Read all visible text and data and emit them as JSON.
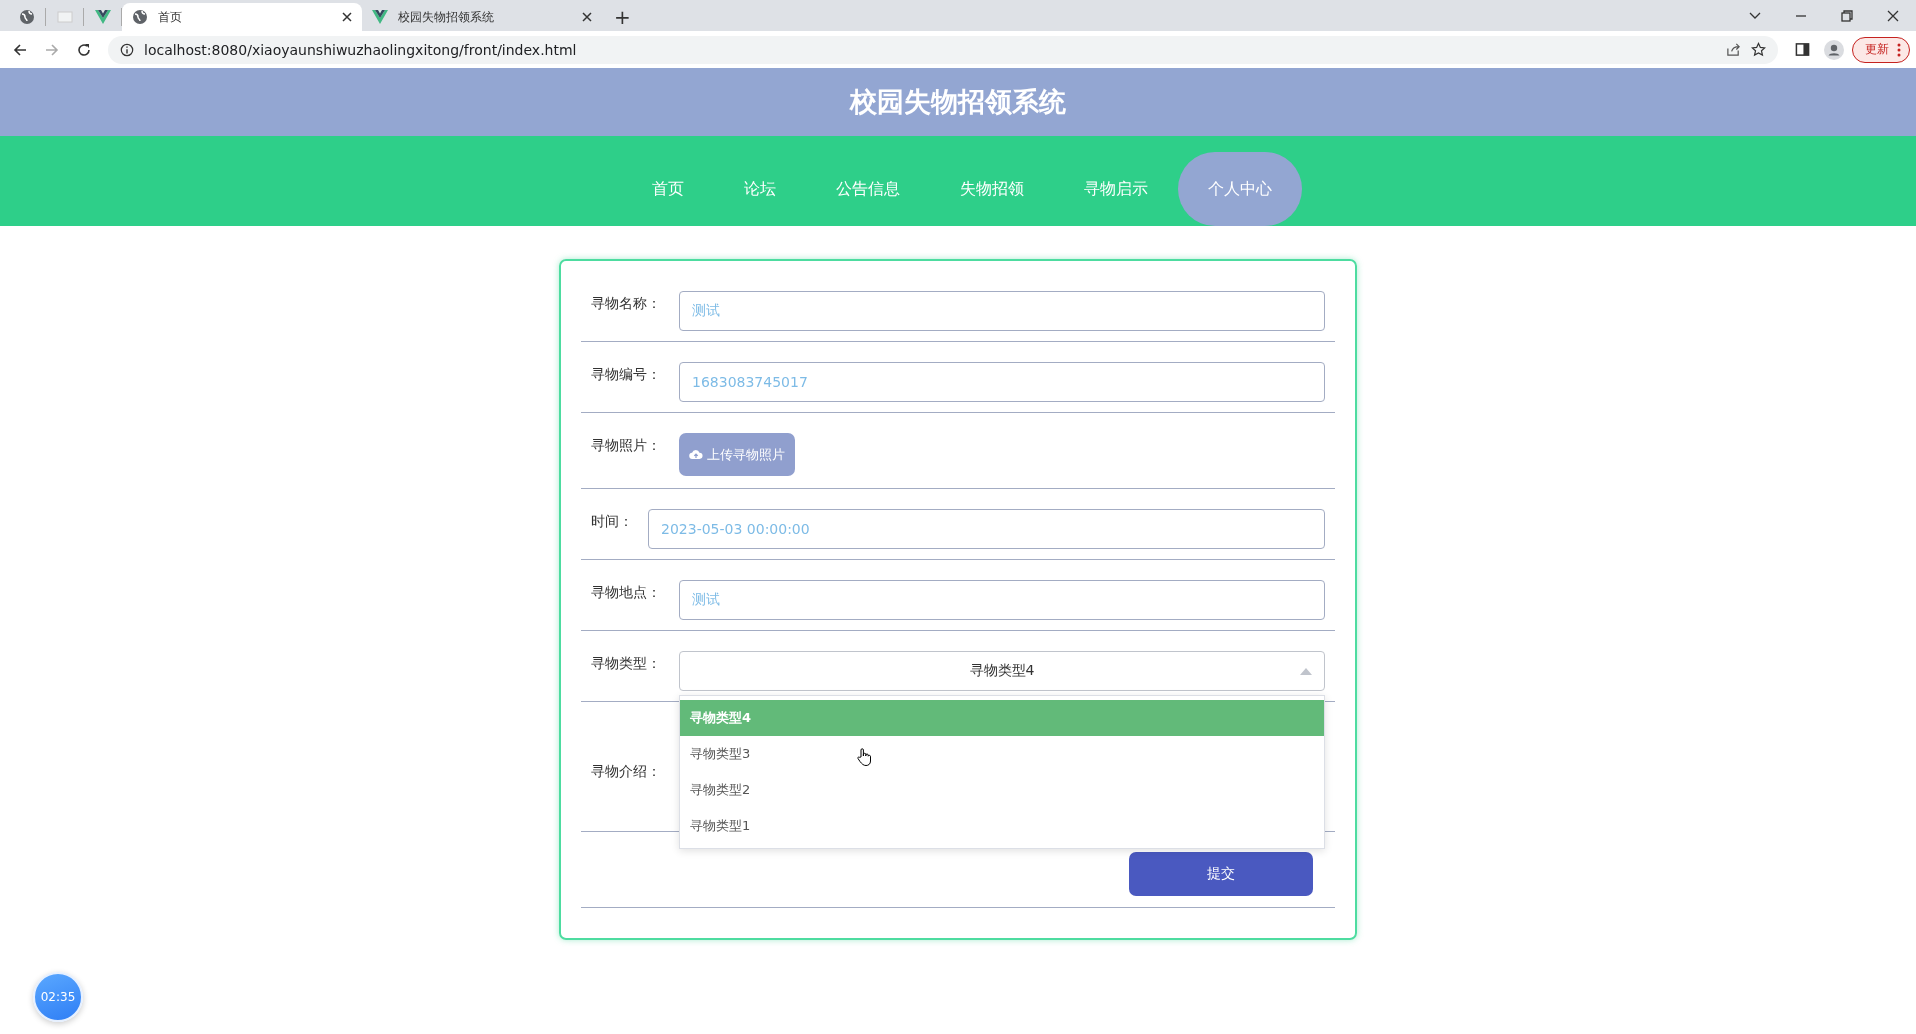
{
  "browser": {
    "tabs": [
      {
        "kind": "globe",
        "selected": false
      },
      {
        "kind": "blank",
        "selected": false
      },
      {
        "kind": "vue",
        "selected": false
      },
      {
        "kind": "globe",
        "title": "首页",
        "selected": true
      },
      {
        "kind": "vue",
        "title": "校园失物招领系统",
        "selected": false
      }
    ],
    "new_tab": "+",
    "address": "localhost:8080/xiaoyaunshiwuzhaolingxitong/front/index.html",
    "update_button": "更新"
  },
  "site": {
    "title": "校园失物招领系统",
    "nav": [
      {
        "label": "首页",
        "selected": false
      },
      {
        "label": "论坛",
        "selected": false
      },
      {
        "label": "公告信息",
        "selected": false
      },
      {
        "label": "失物招领",
        "selected": false
      },
      {
        "label": "寻物启示",
        "selected": false
      },
      {
        "label": "个人中心",
        "selected": true
      }
    ]
  },
  "form": {
    "fields": [
      {
        "kind": "text",
        "label": "寻物名称：",
        "value": "测试"
      },
      {
        "kind": "text",
        "label": "寻物编号：",
        "value": "1683083745017"
      },
      {
        "kind": "upload",
        "label": "寻物照片：",
        "button": "上传寻物照片"
      },
      {
        "kind": "text",
        "label": "时间：",
        "value": "2023-05-03 00:00:00"
      },
      {
        "kind": "text",
        "label": "寻物地点：",
        "value": "测试"
      },
      {
        "kind": "select",
        "label": "寻物类型：",
        "value": "寻物类型4",
        "expanded": true,
        "options": [
          {
            "label": "寻物类型4",
            "selected": true
          },
          {
            "label": "寻物类型3",
            "selected": false
          },
          {
            "label": "寻物类型2",
            "selected": false
          },
          {
            "label": "寻物类型1",
            "selected": false
          }
        ]
      },
      {
        "kind": "textarea",
        "label": "寻物介绍："
      }
    ],
    "submit": "提交"
  },
  "timer": "02:35"
}
